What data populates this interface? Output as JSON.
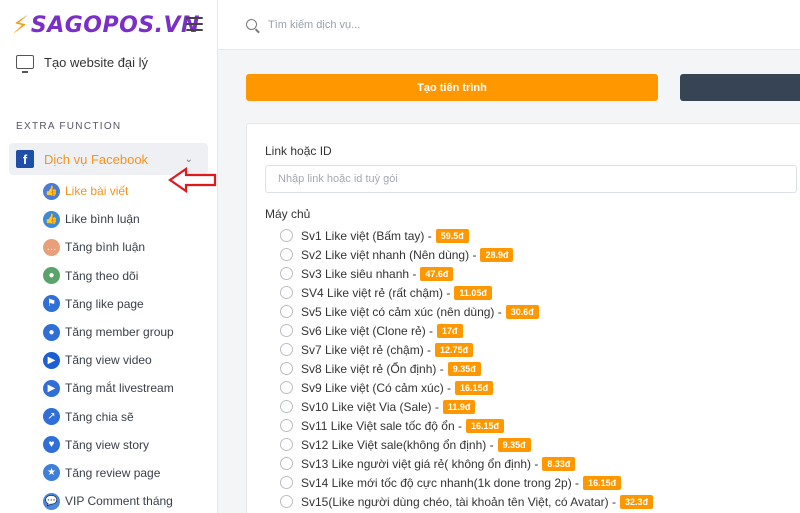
{
  "brand": {
    "bolt": "⚡",
    "name": "SAGOPOS.VN"
  },
  "sidebar": {
    "top_item": "Tạo website đại lý",
    "section": "EXTRA FUNCTION",
    "group": {
      "label": "Dịch vụ Facebook"
    },
    "items": [
      {
        "label": "Like bài viết",
        "icon": "thumbs-up-icon",
        "color": "#4a7bd6",
        "glyph": "👍"
      },
      {
        "label": "Like bình luận",
        "icon": "thumbs-up-comment-icon",
        "color": "#3b8bd9",
        "glyph": "👍"
      },
      {
        "label": "Tăng bình luận",
        "icon": "comment-bubbles-icon",
        "color": "#e9a07a",
        "glyph": "…"
      },
      {
        "label": "Tăng theo dõi",
        "icon": "follower-avatar-icon",
        "color": "#5aa36b",
        "glyph": "●"
      },
      {
        "label": "Tăng like page",
        "icon": "page-flag-icon",
        "color": "#2f6fd6",
        "glyph": "⚑"
      },
      {
        "label": "Tăng member group",
        "icon": "group-members-icon",
        "color": "#2f6fd6",
        "glyph": "●"
      },
      {
        "label": "Tăng view video",
        "icon": "play-video-icon",
        "color": "#1c5fd0",
        "glyph": "▶"
      },
      {
        "label": "Tăng mắt livestream",
        "icon": "livestream-icon",
        "color": "#2f6fd6",
        "glyph": "▶"
      },
      {
        "label": "Tăng chia sẽ",
        "icon": "share-arrow-icon",
        "color": "#2f6fd6",
        "glyph": "↗"
      },
      {
        "label": "Tăng view story",
        "icon": "heart-story-icon",
        "color": "#2f6fd6",
        "glyph": "♥"
      },
      {
        "label": "Tăng review page",
        "icon": "review-icon",
        "color": "#3f7fd8",
        "glyph": "★"
      },
      {
        "label": "VIP Comment tháng",
        "icon": "vip-comment-icon",
        "color": "#4a86dd",
        "glyph": "💬"
      }
    ]
  },
  "topbar": {
    "search_placeholder": "Tìm kiếm dịch vụ..."
  },
  "main": {
    "create_button": "Tạo tiến trình",
    "link_label": "Link hoặc ID",
    "link_placeholder": "Nhập link hoặc id tuỳ gói",
    "server_label": "Máy chủ",
    "servers": [
      {
        "label": "Sv1 Like việt (Bấm tay) -",
        "price": "59.5đ"
      },
      {
        "label": "Sv2 Like việt nhanh (Nên dùng) -",
        "price": "28.9đ"
      },
      {
        "label": "Sv3 Like siêu nhanh -",
        "price": "47.6đ"
      },
      {
        "label": "SV4 Like việt rẻ (rất chậm) -",
        "price": "11.05đ"
      },
      {
        "label": "Sv5 Like việt có cảm xúc (nên dùng) -",
        "price": "30.6đ"
      },
      {
        "label": "Sv6 Like việt (Clone rẻ) -",
        "price": "17đ"
      },
      {
        "label": "Sv7 Like việt rẻ (chậm) -",
        "price": "12.75đ"
      },
      {
        "label": "Sv8 Like việt rẻ (Ổn định) -",
        "price": "9.35đ"
      },
      {
        "label": "Sv9 Like việt (Có cảm xúc) -",
        "price": "16.15đ"
      },
      {
        "label": "Sv10 Like việt Via (Sale) -",
        "price": "11.9đ"
      },
      {
        "label": "Sv11 Like Việt sale tốc độ ổn -",
        "price": "16.15đ"
      },
      {
        "label": "Sv12 Like Việt sale(không ổn định) -",
        "price": "9.35đ"
      },
      {
        "label": "Sv13 Like người việt giá rẻ( không ổn định) -",
        "price": "8.33đ"
      },
      {
        "label": "Sv14 Like mới tốc độ cực nhanh(1k done trong 2p) -",
        "price": "16.15đ"
      },
      {
        "label": "Sv15(Like người dùng chéo, tài khoản tên Việt, có Avatar) -",
        "price": "32.3đ"
      }
    ]
  },
  "colors": {
    "accent": "#ff9800",
    "brand": "#7b2fc9",
    "dark_button": "#364454",
    "facebook": "#1f4ea8"
  }
}
